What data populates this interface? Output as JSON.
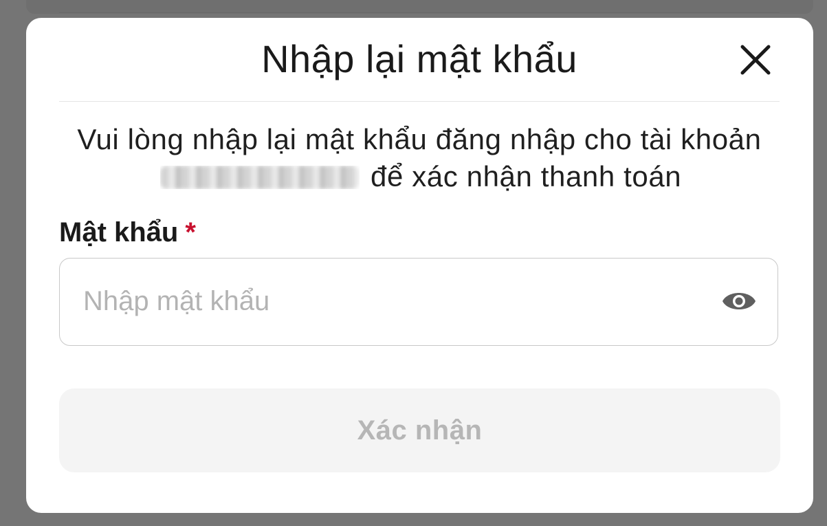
{
  "dialog": {
    "title": "Nhập lại mật khẩu",
    "close_icon": "close-icon"
  },
  "description": {
    "before_account": "Vui lòng nhập lại mật khẩu đăng nhập cho tài khoản",
    "account_masked": "0935067113",
    "after_account": "để xác nhận thanh toán"
  },
  "password": {
    "label": "Mật khẩu",
    "required_mark": "*",
    "placeholder": "Nhập mật khẩu",
    "value": "",
    "toggle_icon": "eye-icon"
  },
  "confirm_button": {
    "label": "Xác nhận",
    "disabled": true
  },
  "colors": {
    "overlay": "#757575",
    "required": "#c8102e",
    "button_disabled_bg": "#f4f4f4",
    "button_disabled_text": "#b6b6b6"
  }
}
